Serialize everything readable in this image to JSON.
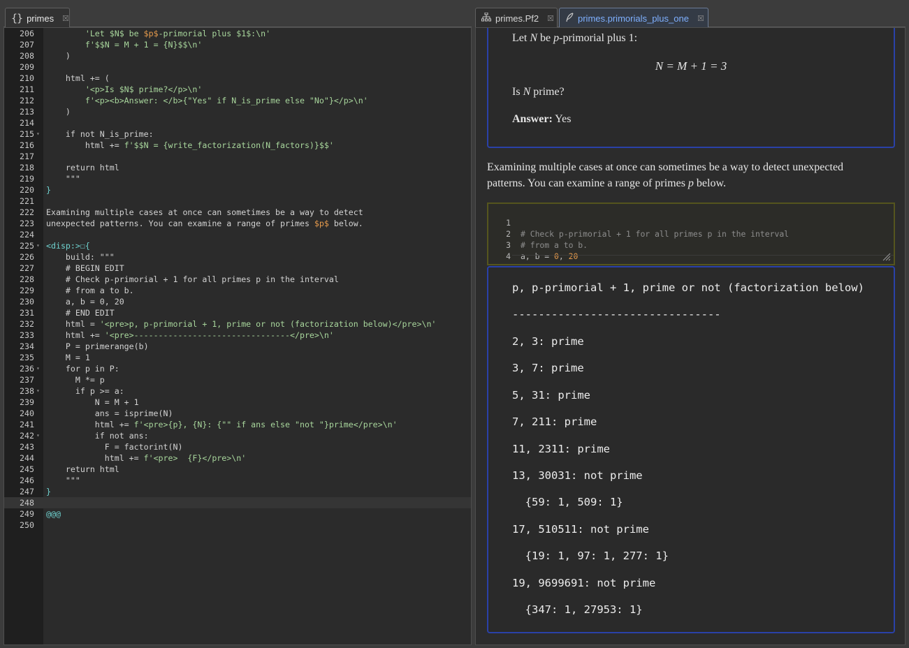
{
  "tabs_left": [
    {
      "label": "primes",
      "icon": "braces-icon",
      "close": "☒"
    }
  ],
  "tabs_right": [
    {
      "label": "primes.Pf2",
      "icon": "sitemap-icon",
      "close": "☒"
    },
    {
      "label": "primes.primorials_plus_one",
      "icon": "feather-icon",
      "close": "☒"
    }
  ],
  "editor": {
    "lines": [
      {
        "n": "206",
        "t": "        'Let $N$ be $p$-primorial plus $1$:\\n'"
      },
      {
        "n": "207",
        "t": "        f'$$N = M + 1 = {N}$$\\n'"
      },
      {
        "n": "208",
        "t": "    )"
      },
      {
        "n": "209",
        "t": ""
      },
      {
        "n": "210",
        "t": "    html += ("
      },
      {
        "n": "211",
        "t": "        '<p>Is $N$ prime?</p>\\n'"
      },
      {
        "n": "212",
        "t": "        f'<p><b>Answer: </b>{\"Yes\" if N_is_prime else \"No\"}</p>\\n'"
      },
      {
        "n": "213",
        "t": "    )"
      },
      {
        "n": "214",
        "t": ""
      },
      {
        "n": "215",
        "t": "    if not N_is_prime:",
        "fold": true
      },
      {
        "n": "216",
        "t": "        html += f'$$N = {write_factorization(N_factors)}$$'"
      },
      {
        "n": "217",
        "t": ""
      },
      {
        "n": "218",
        "t": "    return html"
      },
      {
        "n": "219",
        "t": "    \"\"\""
      },
      {
        "n": "220",
        "t": "}"
      },
      {
        "n": "221",
        "t": ""
      },
      {
        "n": "222",
        "t": "Examining multiple cases at once can sometimes be a way to detect"
      },
      {
        "n": "223",
        "t": "unexpected patterns. You can examine a range of primes $p$ below."
      },
      {
        "n": "224",
        "t": ""
      },
      {
        "n": "225",
        "t": "<disp:>☐{",
        "fold": true
      },
      {
        "n": "226",
        "t": "    build: \"\"\""
      },
      {
        "n": "227",
        "t": "    # BEGIN EDIT"
      },
      {
        "n": "228",
        "t": "    # Check p-primorial + 1 for all primes p in the interval"
      },
      {
        "n": "229",
        "t": "    # from a to b."
      },
      {
        "n": "230",
        "t": "    a, b = 0, 20"
      },
      {
        "n": "231",
        "t": "    # END EDIT"
      },
      {
        "n": "232",
        "t": "    html = '<pre>p, p-primorial + 1, prime or not (factorization below)</pre>\\n'"
      },
      {
        "n": "233",
        "t": "    html += '<pre>--------------------------------</pre>\\n'"
      },
      {
        "n": "234",
        "t": "    P = primerange(b)"
      },
      {
        "n": "235",
        "t": "    M = 1"
      },
      {
        "n": "236",
        "t": "    for p in P:",
        "fold": true
      },
      {
        "n": "237",
        "t": "      M *= p"
      },
      {
        "n": "238",
        "t": "      if p >= a:",
        "fold": true
      },
      {
        "n": "239",
        "t": "          N = M + 1"
      },
      {
        "n": "240",
        "t": "          ans = isprime(N)"
      },
      {
        "n": "241",
        "t": "          html += f'<pre>{p}, {N}: {\"\" if ans else \"not \"}prime</pre>\\n'"
      },
      {
        "n": "242",
        "t": "          if not ans:",
        "fold": true
      },
      {
        "n": "243",
        "t": "            F = factorint(N)"
      },
      {
        "n": "244",
        "t": "            html += f'<pre>  {F}</pre>\\n'"
      },
      {
        "n": "245",
        "t": "    return html"
      },
      {
        "n": "246",
        "t": "    \"\"\""
      },
      {
        "n": "247",
        "t": "}"
      },
      {
        "n": "248",
        "t": "",
        "current": true
      },
      {
        "n": "249",
        "t": "@@@"
      },
      {
        "n": "250",
        "t": ""
      }
    ]
  },
  "preview": {
    "p1_prefix": "Let ",
    "p1_N": "N",
    "p1_mid": " be ",
    "p1_p": "p",
    "p1_suffix": "-primorial plus 1:",
    "math": "N = M + 1 = 3",
    "p2_prefix": "Is ",
    "p2_N": "N",
    "p2_suffix": " prime?",
    "answer_label": "Answer:",
    "answer_value": " Yes",
    "intro_1": "Examining multiple cases at once can sometimes be a way to detect unexpected",
    "intro_2a": "patterns. You can examine a range of primes ",
    "intro_2p": "p",
    "intro_2b": " below.",
    "mini_lines": [
      {
        "n": "1",
        "t": "# Check p-primorial + 1 for all primes p in the interval"
      },
      {
        "n": "2",
        "t": "# from a to b."
      },
      {
        "n": "3",
        "a": "a, b = ",
        "v1": "0",
        "sep": ", ",
        "v2": "20"
      },
      {
        "n": "4",
        "t": ""
      }
    ],
    "output": [
      "p, p-primorial + 1, prime or not (factorization below)",
      "--------------------------------",
      "2, 3: prime",
      "3, 7: prime",
      "5, 31: prime",
      "7, 211: prime",
      "11, 2311: prime",
      "13, 30031: not prime",
      "  {59: 1, 509: 1}",
      "17, 510511: not prime",
      "  {19: 1, 97: 1, 277: 1}",
      "19, 9699691: not prime",
      "  {347: 1, 27953: 1}"
    ]
  },
  "colors": {
    "card_border": "#2a41a8",
    "mini_editor_border": "#55551e",
    "string": "#a8d69c",
    "tag": "#6fd2cf",
    "number": "#e59a4c"
  }
}
